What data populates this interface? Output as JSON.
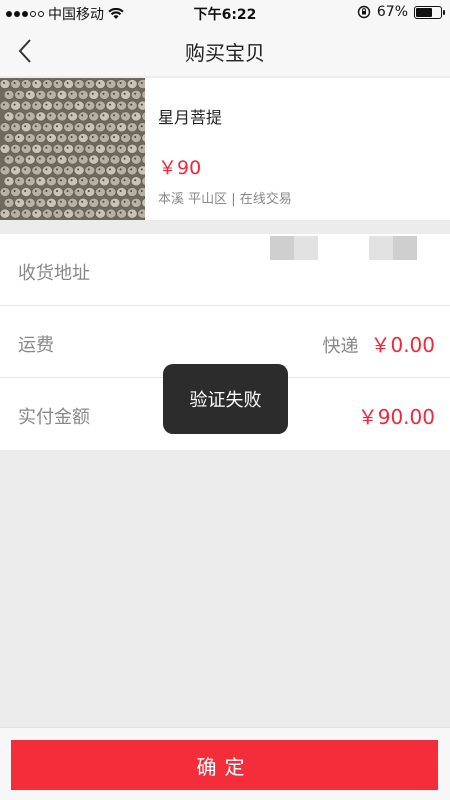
{
  "status_bar": {
    "carrier": "中国移动",
    "time": "下午6:22",
    "battery_text": "67%",
    "battery_level": 0.67,
    "icons": [
      "signal-dots",
      "wifi-icon",
      "orientation-lock-icon",
      "battery-icon"
    ]
  },
  "nav": {
    "title": "购买宝贝",
    "back_icon": "chevron-left-icon"
  },
  "product": {
    "name": "星月菩提",
    "price": "￥90",
    "location": "本溪 平山区 | 在线交易"
  },
  "rows": {
    "address": {
      "label": "收货地址"
    },
    "shipping": {
      "label": "运费",
      "method": "快递",
      "value": "￥0.00"
    },
    "total": {
      "label": "实付金额",
      "value": "￥90.00"
    }
  },
  "toast": {
    "text": "验证失败"
  },
  "footer": {
    "confirm_label": "确定"
  },
  "colors": {
    "accent_red": "#f52d3a",
    "price_red": "#f0283a",
    "toast_bg": "#2c2c2c"
  }
}
